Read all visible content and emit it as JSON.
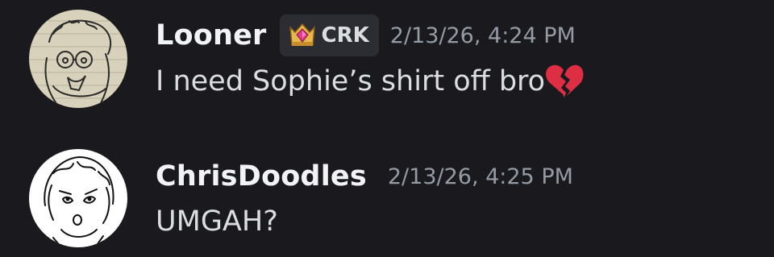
{
  "messages": [
    {
      "username": "Looner",
      "tag": {
        "label": "CRK",
        "icon": "crown-gem-icon"
      },
      "timestamp": "2/13/26, 4:24 PM",
      "text": "I need Sophie’s shirt off bro",
      "emoji": "broken-heart-icon"
    },
    {
      "username": "ChrisDoodles",
      "timestamp": "2/13/26, 4:25 PM",
      "text": "UMGAH?"
    }
  ],
  "colors": {
    "background": "#1a1a1e",
    "username": "#f2f3f5",
    "message_text": "#dbdee1",
    "timestamp": "#949ba4",
    "tag_background": "#2c2d33"
  }
}
